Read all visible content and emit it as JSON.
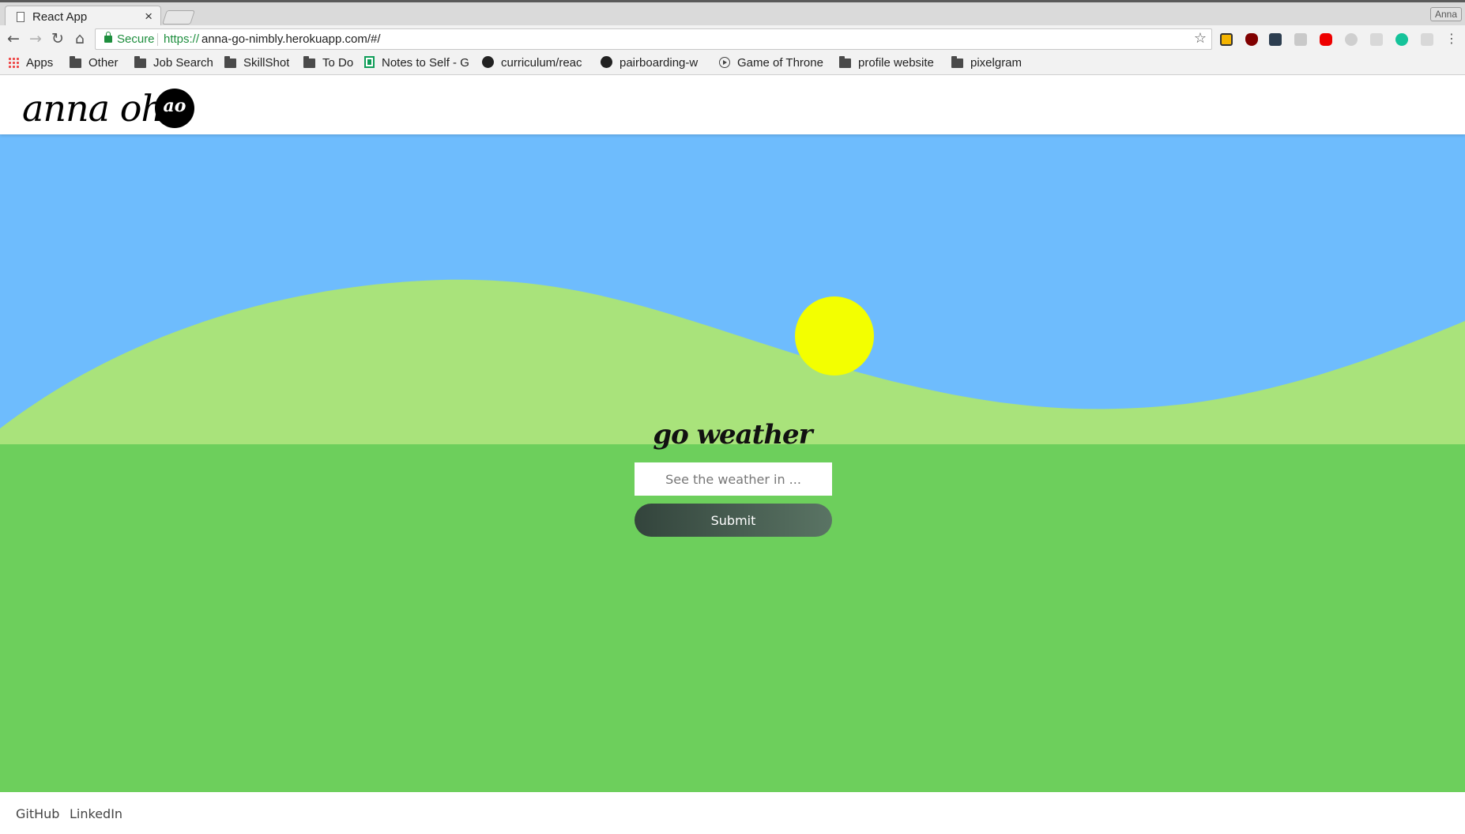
{
  "browser": {
    "tab_title": "React App",
    "tab_close": "×",
    "profile_name": "Anna",
    "security_label": "Secure",
    "url_scheme": "https://",
    "url_rest": "anna-go-nimbly.herokuapp.com/#/",
    "bookmarks": [
      {
        "label": "Apps",
        "icon": "apps-grid-icon"
      },
      {
        "label": "Other",
        "icon": "folder-icon"
      },
      {
        "label": "Job Search",
        "icon": "folder-icon"
      },
      {
        "label": "SkillShot",
        "icon": "folder-icon"
      },
      {
        "label": "To Do",
        "icon": "folder-icon"
      },
      {
        "label": "Notes to Self - G",
        "icon": "sheets-icon"
      },
      {
        "label": "curriculum/reac",
        "icon": "github-icon"
      },
      {
        "label": "pairboarding-w",
        "icon": "github-icon"
      },
      {
        "label": "Game of Throne",
        "icon": "play-icon"
      },
      {
        "label": "profile website",
        "icon": "folder-icon"
      },
      {
        "label": "pixelgram",
        "icon": "folder-icon"
      }
    ]
  },
  "site": {
    "logo_text": "anna oh",
    "logo_mark": "ao",
    "app_title": "go weather",
    "search_placeholder": "See the weather in ...",
    "submit_label": "Submit",
    "footer_links": [
      "GitHub",
      "LinkedIn"
    ]
  },
  "colors": {
    "sky": "#6ebcfd",
    "hill": "#a9e37b",
    "ground": "#6dcf5c",
    "sun": "#f3ff00"
  }
}
